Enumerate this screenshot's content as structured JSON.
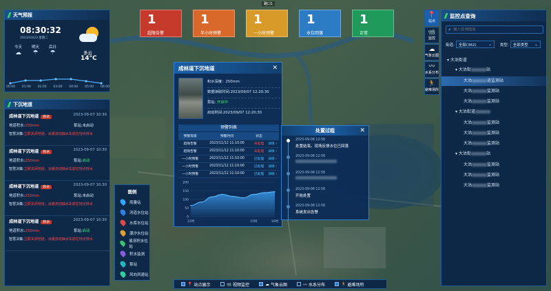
{
  "top_marker": "路口1",
  "weather": {
    "title": "天气预报",
    "time": "08:30:32",
    "date": "2023/03/23",
    "weekday": "星期二",
    "days": [
      {
        "label": "今天"
      },
      {
        "label": "明天"
      },
      {
        "label": "后日"
      }
    ],
    "current_desc": "多云",
    "current_temp": "14°C",
    "times": [
      "00:00",
      "01:00",
      "02:00",
      "03:00",
      "04:00",
      "05:00",
      "06:00"
    ]
  },
  "subsidence": {
    "title": "下沉地道",
    "items": [
      {
        "name": "成林道下沉地道",
        "tag": "积水",
        "time": "2023-09-07 10:30",
        "depth_label": "地道积水:",
        "depth": "250mm",
        "pump_label": "泵站:",
        "pump": "未启动",
        "pump_state": "off",
        "advice_label": "智慧决策:",
        "advice": "立即关闭地道，派遣流动抽水车前往地点排水"
      },
      {
        "name": "成林道下沉地道",
        "tag": "积水",
        "time": "2023-09-07 10:30",
        "depth_label": "地道积水:",
        "depth": "250mm",
        "pump_label": "泵站:",
        "pump": "启动",
        "pump_state": "on",
        "advice_label": "智慧决策:",
        "advice": "立即关闭地道，派遣流动抽水车前往地点排水"
      },
      {
        "name": "成林道下沉地道",
        "tag": "积水",
        "time": "2023-09-07 10:30",
        "depth_label": "地道积水:",
        "depth": "250mm",
        "pump_label": "泵站:",
        "pump": "未启动",
        "pump_state": "off",
        "advice_label": "智慧决策:",
        "advice": "立即关闭地道，派遣流动抽水车前往地点排水"
      },
      {
        "name": "成林道下沉地道",
        "tag": "积水",
        "time": "2023-09-07 10:30",
        "depth_label": "地道积水:",
        "depth": "250mm",
        "pump_label": "泵站:",
        "pump": "启动",
        "pump_state": "on",
        "advice_label": "智慧决策:",
        "advice": "立即关闭地道，派遣流动抽水车前往地点排水"
      }
    ]
  },
  "alerts": [
    {
      "num": "1",
      "label": "超限告警",
      "color": "#c63a2c"
    },
    {
      "num": "1",
      "label": "半小时预警",
      "color": "#d8692a"
    },
    {
      "num": "1",
      "label": "一小时预警",
      "color": "#d89a28"
    },
    {
      "num": "1",
      "label": "水位回落",
      "color": "#2b7cc4"
    },
    {
      "num": "1",
      "label": "正常",
      "color": "#1f9a5a"
    }
  ],
  "right_icons": [
    {
      "icon": "📍",
      "label": "站点"
    },
    {
      "icon": "📹",
      "label": "监控"
    },
    {
      "icon": "☁",
      "label": "气象云图"
    },
    {
      "icon": "〰",
      "label": "水系分布"
    },
    {
      "icon": "🏃",
      "label": "避难场所"
    }
  ],
  "monitor": {
    "title": "监控点查询",
    "search_placeholder": "输入查询图层",
    "street_label": "街道:",
    "street_value": "全部(362)",
    "type_label": "类型:",
    "type_value": "全部类型",
    "tree": [
      {
        "level": 0,
        "text": "大沽街道"
      },
      {
        "level": 1,
        "text": "大沽街",
        "suffix": "站"
      },
      {
        "level": 2,
        "text": "大沽",
        "suffix": "道监测站",
        "selected": true
      },
      {
        "level": 2,
        "text": "大沽",
        "suffix": "监测站"
      },
      {
        "level": 2,
        "text": "大沽",
        "suffix": "监测站"
      },
      {
        "level": 1,
        "text": "大沽街道",
        "suffix": ""
      },
      {
        "level": 2,
        "text": "大沽",
        "suffix": "监测站"
      },
      {
        "level": 2,
        "text": "大沽",
        "suffix": "监测站"
      },
      {
        "level": 2,
        "text": "大沽",
        "suffix": "监测站"
      },
      {
        "level": 1,
        "text": "大沽街",
        "suffix": "站"
      },
      {
        "level": 2,
        "text": "大沽",
        "suffix": "监测站"
      },
      {
        "level": 2,
        "text": "大沽",
        "suffix": "监测站"
      },
      {
        "level": 2,
        "text": "大沽",
        "suffix": "监测站"
      }
    ]
  },
  "legend": {
    "title": "图例",
    "items": [
      {
        "label": "雨量站",
        "color": "#2fa8ff"
      },
      {
        "label": "河道水位站",
        "color": "#2f7ee0"
      },
      {
        "label": "水库水位站",
        "color": "#e04848"
      },
      {
        "label": "潮汐水位站",
        "color": "#e0a030"
      },
      {
        "label": "易涝积水位站",
        "color": "#38c470"
      },
      {
        "label": "积水监测",
        "color": "#8a5ae0"
      },
      {
        "label": "泵站",
        "color": "#20b8c0"
      },
      {
        "label": "风向风速站",
        "color": "#2fd0a0"
      }
    ]
  },
  "popup": {
    "title": "成林道下沉地道",
    "depth_label": "积水深度：",
    "depth": "250mm",
    "time_label": "数据读取时间:",
    "time": "2023/09/07 12:20:30",
    "pump_label": "泵站:",
    "pump": "开启中",
    "start_label": "启动时间:",
    "start_time": "2023/09/07 12:20:30",
    "table_title": "预警列表",
    "headers": [
      "预警等级",
      "预警时间",
      "状态",
      ""
    ],
    "rows": [
      {
        "level": "超限告警",
        "time": "2023/11/12 11:10:00",
        "status": "未处理",
        "op": "详情"
      },
      {
        "level": "超限告警",
        "time": "2023/11/12 11:10:00",
        "status": "未处理",
        "op": "详情"
      },
      {
        "level": "一小时预警",
        "time": "2023/11/12 11:10:00",
        "status": "已处理",
        "op": "详情"
      },
      {
        "level": "一小时预警",
        "time": "2023/11/12 11:10:00",
        "status": "已处理",
        "op": "详情"
      },
      {
        "level": "一小时预警",
        "time": "2023/11/12 11:10:00",
        "status": "已处理",
        "op": "详情"
      }
    ]
  },
  "chart_data": {
    "type": "area",
    "x": [
      "12时",
      "",
      "",
      "",
      "",
      "",
      "15时",
      "",
      "16时"
    ],
    "values": [
      65,
      85,
      115,
      130,
      118,
      110,
      130,
      140,
      145
    ],
    "ylim": [
      0,
      200
    ],
    "yticks": [
      0,
      50,
      100,
      150,
      200
    ]
  },
  "process": {
    "title": "处置过程",
    "steps": [
      {
        "time": "2023-09-08 12:56",
        "text": "处置结束。现场反馈水位已回落"
      },
      {
        "time": "2023-09-08 12:56",
        "text": ""
      },
      {
        "time": "2023-09-08 12:56",
        "text": ""
      },
      {
        "time": "2023-09-08 12:56",
        "text": "开始处置"
      },
      {
        "time": "2023-09-08 12:56",
        "text": "系统发出告警"
      }
    ]
  },
  "toolbar": [
    {
      "label": "站点展示",
      "icon": "📍",
      "on": true
    },
    {
      "label": "视频监控",
      "icon": "📹",
      "on": false
    },
    {
      "label": "气象云图",
      "icon": "☁",
      "on": true
    },
    {
      "label": "水系分布",
      "icon": "〰",
      "on": false
    },
    {
      "label": "避难场所",
      "icon": "🏃",
      "on": true
    }
  ]
}
